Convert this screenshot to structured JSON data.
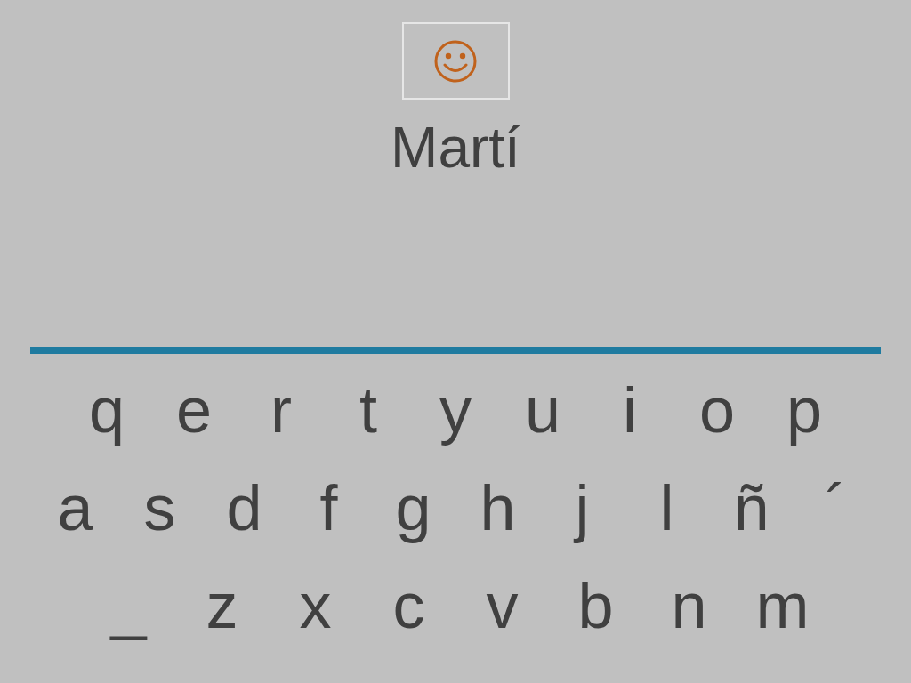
{
  "word": "Martí",
  "keyboard": {
    "rows": [
      [
        "q",
        "e",
        "r",
        "t",
        "y",
        "u",
        "i",
        "o",
        "p"
      ],
      [
        "a",
        "s",
        "d",
        "f",
        "g",
        "h",
        "j",
        "l",
        "ñ",
        "´"
      ],
      [
        "_",
        "z",
        "x",
        "c",
        "v",
        "b",
        "n",
        "m"
      ]
    ]
  }
}
